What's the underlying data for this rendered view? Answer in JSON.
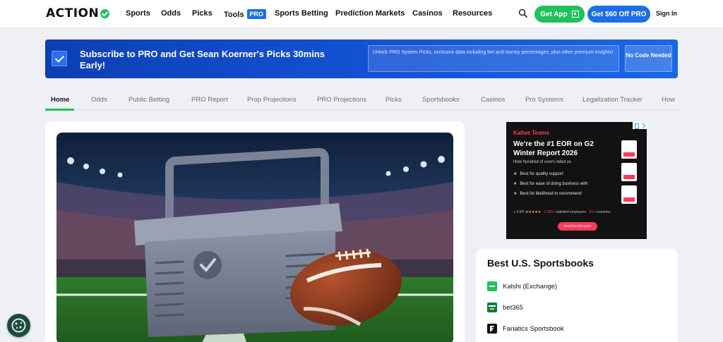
{
  "header": {
    "logo": "ACTION",
    "nav": [
      "Sports",
      "Odds",
      "Picks",
      "Tools",
      "Sports Betting",
      "Prediction Markets",
      "Casinos",
      "Resources"
    ],
    "tools_badge": "PRO",
    "get_app": "Get App",
    "get_offer": "Get $60 Off PRO",
    "sign_in": "Sign In"
  },
  "banner": {
    "title": "Subscribe to PRO and Get Sean Koerner's Picks 30mins Early!",
    "description": "Unlock PRO System Picks, exclusive data including bet and money percentages, plus other premium insights!",
    "button": "No Code Needed"
  },
  "subnav": {
    "tabs": [
      "Home",
      "Odds",
      "Public Betting",
      "PRO Report",
      "Prop Projections",
      "PRO Projections",
      "Picks",
      "Sportsbooks",
      "Casinos",
      "Pro Systems",
      "Legalization Tracker",
      "How"
    ],
    "active": "Home"
  },
  "ad": {
    "brand": "Kative Teams",
    "headline": "We're the #1 EOR on G2 Winter Report 2026",
    "subline": "How hundred of users rated us",
    "points": [
      "Best for quality support",
      "Best for ease of doing business with",
      "Best for likelihood to recommend"
    ],
    "rating": "4.9/5",
    "stars": "★★★★★",
    "employers": "3,000+",
    "employers_label": "satisfied employers",
    "countries": "60+",
    "countries_label": "countries",
    "cta": "Read the full report"
  },
  "sportsbooks": {
    "title": "Best U.S. Sportsbooks",
    "items": [
      {
        "name": "Kalshi (Exchange)",
        "color": "#1ec15b",
        "mark": "Kalshi"
      },
      {
        "name": "bet365",
        "color": "#0b7a4b",
        "mark": "bet365"
      },
      {
        "name": "Fanatics Sportsbook",
        "color": "#111111",
        "mark": "F"
      }
    ]
  },
  "colors": {
    "brand_green": "#1ec15b",
    "brand_blue": "#1c6ee6"
  }
}
